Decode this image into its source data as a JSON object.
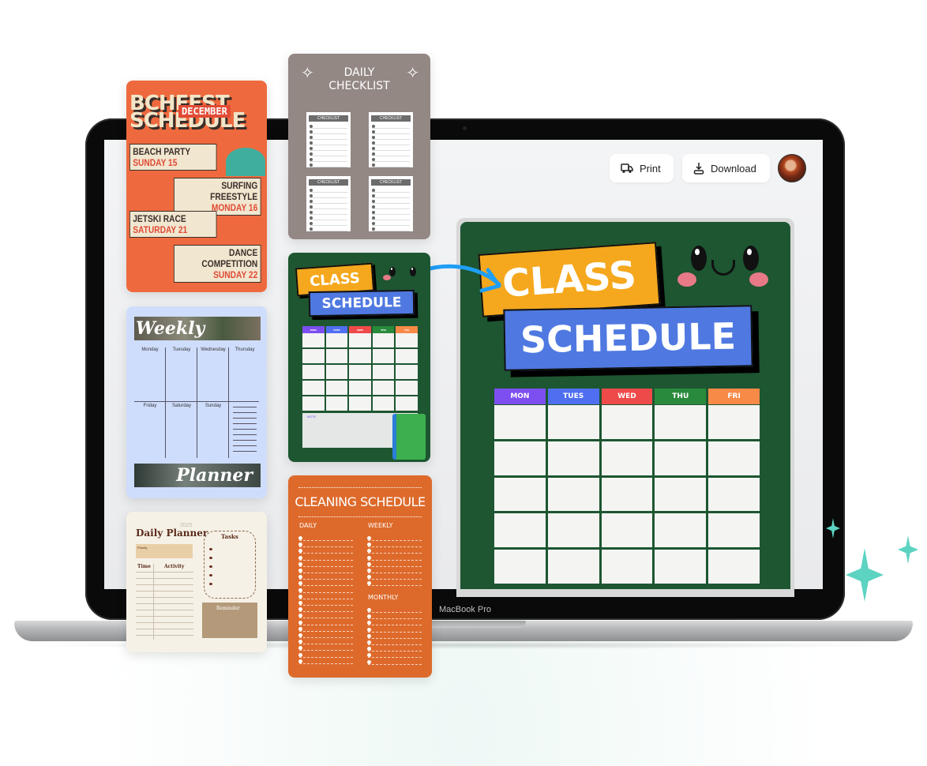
{
  "device": {
    "label": "MacBook Pro"
  },
  "toolbar": {
    "print_label": "Print",
    "print_icon": "truck-icon",
    "download_label": "Download",
    "download_icon": "download-icon",
    "avatar": "user-avatar"
  },
  "preview": {
    "title_line1": "CLASS",
    "title_line2": "SCHEDULE",
    "days": [
      "MON",
      "TUES",
      "WED",
      "THU",
      "FRI"
    ],
    "day_colors": [
      "#7d4ef0",
      "#4f6ff0",
      "#ef4a4a",
      "#2a8a3c",
      "#f88a48"
    ],
    "rows": 5,
    "background": "#1d5631"
  },
  "templates": {
    "beach_fest": {
      "title_line1": "BCHFEST",
      "title_line2": "SCHEDULE",
      "month": "DECEMBER",
      "events": [
        {
          "name": "BEACH PARTY",
          "date": "SUNDAY 15"
        },
        {
          "name": "SURFING FREESTYLE",
          "date": "MONDAY 16"
        },
        {
          "name": "JETSKI RACE",
          "date": "SATURDAY 21"
        },
        {
          "name": "DANCE COMPETITION",
          "date": "SUNDAY 22"
        }
      ]
    },
    "daily_checklist": {
      "title_line1": "DAILY",
      "title_line2": "CHECKLIST",
      "card_label": "CHECKLIST"
    },
    "weekly_planner": {
      "title_top": "Weekly",
      "title_bottom": "Planner",
      "days": [
        "Monday",
        "Tuesday",
        "Wednesday",
        "Thursday",
        "Friday",
        "Saturday",
        "Sunday"
      ]
    },
    "daily_planner": {
      "title": "Daily Planner",
      "year": "2025",
      "priority_label": "Priority",
      "time_label": "Time",
      "activity_label": "Activity",
      "tasks_label": "Tasks",
      "reminder_label": "Reminder"
    },
    "class_schedule": {
      "title_line1": "CLASS",
      "title_line2": "SCHEDULE",
      "days": [
        "MON",
        "TUES",
        "WED",
        "THU",
        "FRI"
      ],
      "note_label": "NOTE"
    },
    "cleaning_schedule": {
      "title": "CLEANING SCHEDULE",
      "daily_label": "DAILY",
      "weekly_label": "WEEKLY",
      "monthly_label": "MONTHLY"
    }
  }
}
